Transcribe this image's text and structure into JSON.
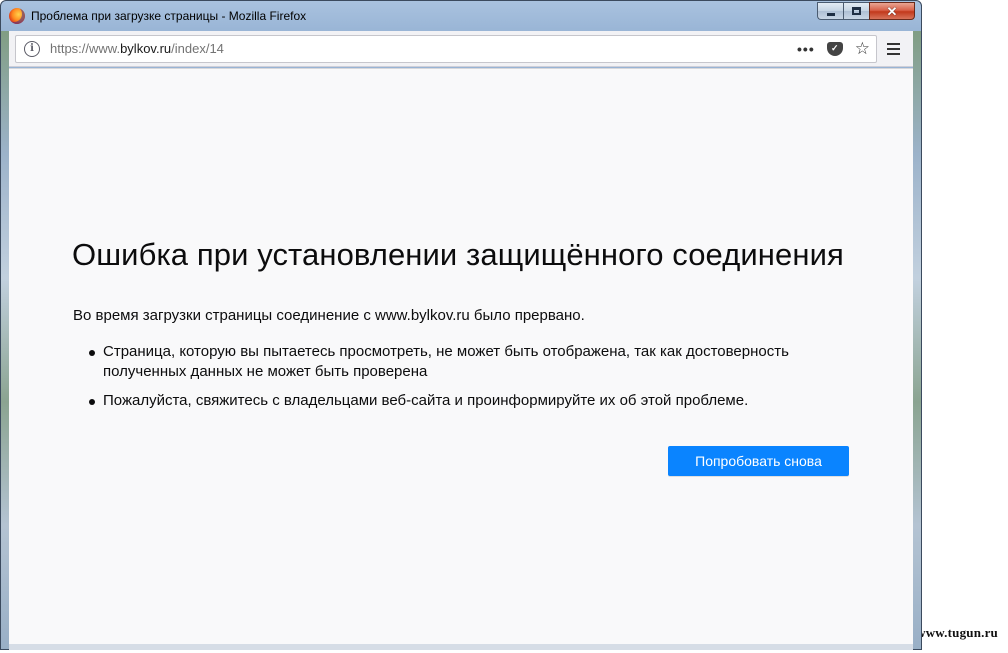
{
  "window": {
    "title": "Проблема при загрузке страницы - Mozilla Firefox",
    "controls": {
      "minimize_icon": "minimize-icon",
      "maximize_icon": "maximize-icon",
      "close_icon": "close-icon",
      "close_glyph": "✕"
    }
  },
  "toolbar": {
    "url": {
      "scheme": "https://www.",
      "host": "bylkov.ru",
      "path": "/index/14"
    },
    "page_actions_glyph": "•••",
    "pocket_glyph": "✓",
    "bookmark_glyph": "☆",
    "info_glyph": "i"
  },
  "error_page": {
    "title": "Ошибка при установлении защищённого соединения",
    "description": "Во время загрузки страницы соединение с www.bylkov.ru было прервано.",
    "bullets": [
      "Страница, которую вы пытаетесь просмотреть, не может быть отображена, так как достоверность полученных данных не может быть проверена",
      "Пожалуйста, свяжитесь с владельцами веб-сайта и проинформируйте их об этой проблеме."
    ],
    "retry_label": "Попробовать снова"
  },
  "watermark": "www.tugun.ru",
  "colors": {
    "accent": "#0a84ff",
    "content_bg": "#f9f9fa",
    "text": "#0c0c0d"
  }
}
